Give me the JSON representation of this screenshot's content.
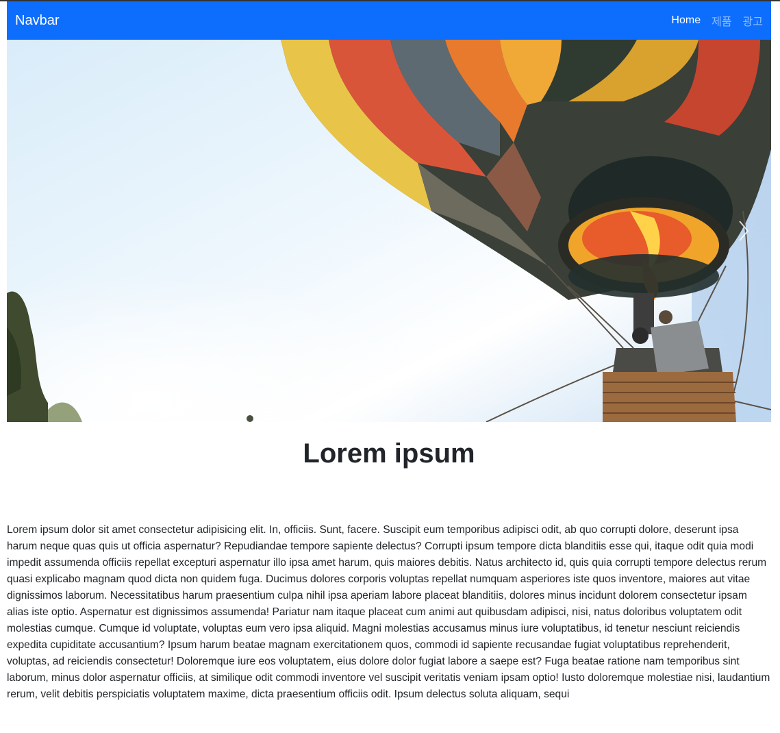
{
  "navbar": {
    "brand": "Navbar",
    "links": [
      {
        "label": "Home",
        "active": true
      },
      {
        "label": "제품",
        "active": false
      },
      {
        "label": "광고",
        "active": false
      }
    ],
    "color": "#0d6efd"
  },
  "carousel": {
    "image": "hot-air-balloon",
    "prev_icon": "chevron-left-icon",
    "next_icon": "chevron-right-icon"
  },
  "main": {
    "title": "Lorem ipsum",
    "paragraph": "Lorem ipsum dolor sit amet consectetur adipisicing elit. In, officiis. Sunt, facere. Suscipit eum temporibus adipisci odit, ab quo corrupti dolore, deserunt ipsa harum neque quas quis ut officia aspernatur? Repudiandae tempore sapiente delectus? Corrupti ipsum tempore dicta blanditiis esse qui, itaque odit quia modi impedit assumenda officiis repellat excepturi aspernatur illo ipsa amet harum, quis maiores debitis. Natus architecto id, quis quia corrupti tempore delectus rerum quasi explicabo magnam quod dicta non quidem fuga. Ducimus dolores corporis voluptas repellat numquam asperiores iste quos inventore, maiores aut vitae dignissimos laborum. Necessitatibus harum praesentium culpa nihil ipsa aperiam labore placeat blanditiis, dolores minus incidunt dolorem consectetur ipsam alias iste optio. Aspernatur est dignissimos assumenda! Pariatur nam itaque placeat cum animi aut quibusdam adipisci, nisi, natus doloribus voluptatem odit molestias cumque. Cumque id voluptate, voluptas eum vero ipsa aliquid. Magni molestias accusamus minus iure voluptatibus, id tenetur nesciunt reiciendis expedita cupiditate accusantium? Ipsum harum beatae magnam exercitationem quos, commodi id sapiente recusandae fugiat voluptatibus reprehenderit, voluptas, ad reiciendis consectetur! Doloremque iure eos voluptatem, eius dolore dolor fugiat labore a saepe est? Fuga beatae ratione nam temporibus sint laborum, minus dolor aspernatur officiis, at similique odit commodi inventore vel suscipit veritatis veniam ipsam optio! Iusto doloremque molestiae nisi, laudantium rerum, velit debitis perspiciatis voluptatem maxime, dicta praesentium officiis odit. Ipsum delectus soluta aliquam, sequi"
  }
}
